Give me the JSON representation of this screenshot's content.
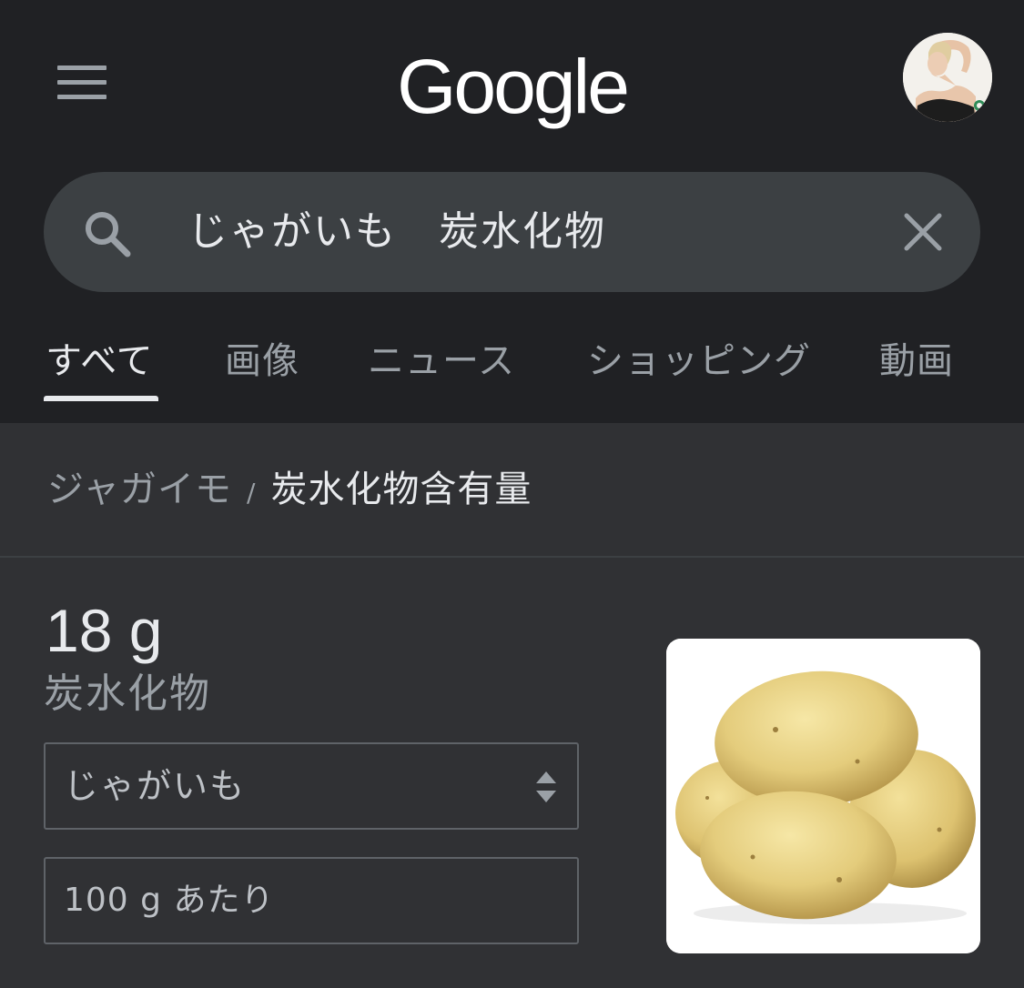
{
  "header": {
    "logo_text": "Google",
    "menu_icon": "hamburger-menu-icon",
    "avatar_icon": "profile-avatar"
  },
  "search": {
    "query": "じゃがいも　炭水化物",
    "search_icon": "search-icon",
    "clear_icon": "close-icon"
  },
  "tabs": [
    {
      "label": "すべて",
      "active": true
    },
    {
      "label": "画像",
      "active": false
    },
    {
      "label": "ニュース",
      "active": false
    },
    {
      "label": "ショッピング",
      "active": false
    },
    {
      "label": "動画",
      "active": false
    }
  ],
  "breadcrumb": {
    "parent": "ジャガイモ",
    "separator": "/",
    "current": "炭水化物含有量"
  },
  "result": {
    "value": "18 g",
    "nutrient": "炭水化物",
    "food_select": "じゃがいも",
    "amount": "100 g あたり",
    "image_icon": "potato-image"
  },
  "colors": {
    "header_bg": "#202124",
    "body_bg": "#303134",
    "search_bg": "#3c4043",
    "text_primary": "#e8eaed",
    "text_secondary": "#9aa0a6"
  }
}
